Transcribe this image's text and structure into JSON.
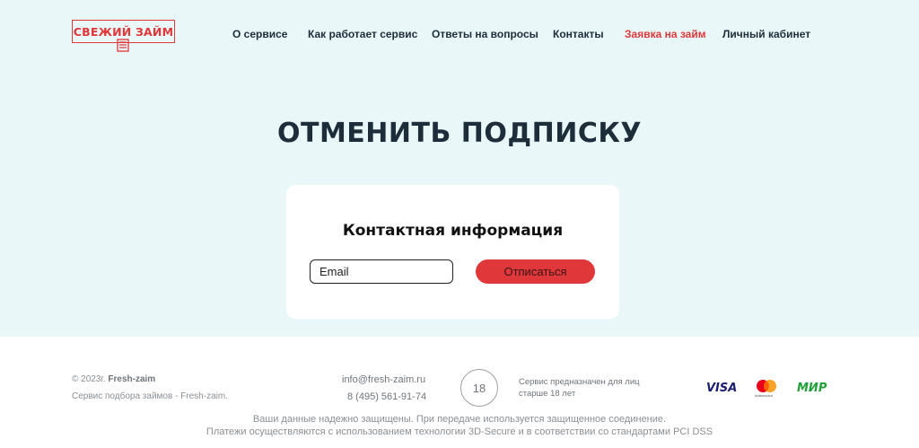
{
  "header": {
    "logo_text": "СВЕЖИЙ ЗАЙМ",
    "nav": [
      {
        "label": "О сервисе",
        "active": false
      },
      {
        "label": "Как работает сервис",
        "active": false
      },
      {
        "label": "Ответы на вопросы",
        "active": false
      },
      {
        "label": "Контакты",
        "active": false
      },
      {
        "label": "Заявка на займ",
        "active": true
      },
      {
        "label": "Личный кабинет",
        "active": false
      }
    ]
  },
  "main": {
    "title": "ОТМЕНИТЬ ПОДПИСКУ",
    "card": {
      "title": "Контактная информация",
      "email_placeholder": "Email",
      "email_value": "",
      "button_label": "Отписаться"
    }
  },
  "footer": {
    "copyright_prefix": "© 2023г.",
    "brand": "Fresh-zaim",
    "description": "Сервис подбора займов - Fresh-zaim.",
    "email": "info@fresh-zaim.ru",
    "phone": "8 (495) 561-91-74",
    "age": "18",
    "age_note": "Сервис предназначен для лиц старше 18 лет",
    "payments": {
      "visa": "VISA",
      "mastercard": "mastercard",
      "mir": "МИР"
    },
    "secure_line1": "Ваши данные надежно защищены. При передаче используется защищенное соединение.",
    "secure_line2": "Платежи осуществляются с использованием технологии 3D-Secure и в соответствии со стандартами PCI DSS"
  },
  "colors": {
    "accent": "#e0383a",
    "hero_bg": "#e9f7f8",
    "text": "#1d2d3a"
  }
}
